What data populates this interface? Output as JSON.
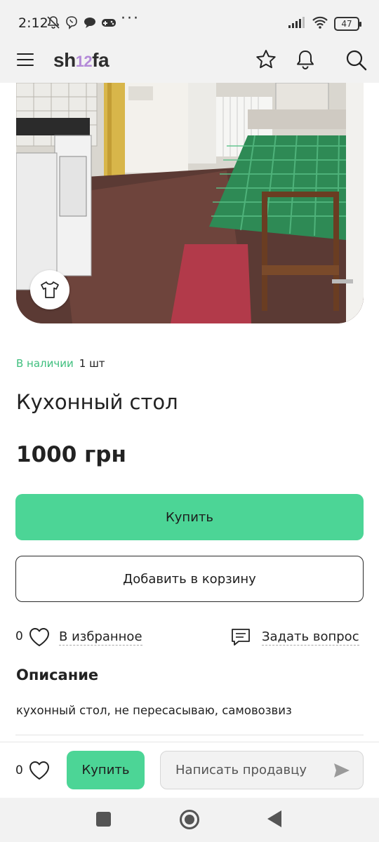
{
  "status_bar": {
    "time": "2:12",
    "more": "···",
    "battery": "47",
    "icons": [
      "notifications-off-icon",
      "viber-icon",
      "chat-bubble-icon",
      "gamepad-icon",
      "signal-icon",
      "wifi-icon",
      "battery-icon"
    ]
  },
  "header": {
    "logo_left": "sh",
    "logo_mid": "12",
    "logo_right": "fa",
    "icons": [
      "menu-icon",
      "star-icon",
      "bell-icon",
      "search-icon"
    ]
  },
  "product": {
    "availability": "В наличии",
    "quantity": "1 шт",
    "title": "Кухонный стол",
    "price": "1000 грн",
    "photo_badge_icon": "tshirt-icon"
  },
  "actions": {
    "buy_label": "Купить",
    "add_to_cart_label": "Добавить в корзину",
    "favorites_count": "0",
    "favorites_label": "В избранное",
    "ask_question_label": "Задать вопрос"
  },
  "description": {
    "heading": "Описание",
    "text": "кухонный стол, не пересасываю, самовозвиз"
  },
  "bottom_bar": {
    "favorites_count": "0",
    "buy_label": "Купить",
    "message_placeholder": "Написать продавцу"
  },
  "colors": {
    "accent": "#4cd596",
    "in_stock": "#3fbf7e",
    "header_bg": "#f2f2f2"
  }
}
